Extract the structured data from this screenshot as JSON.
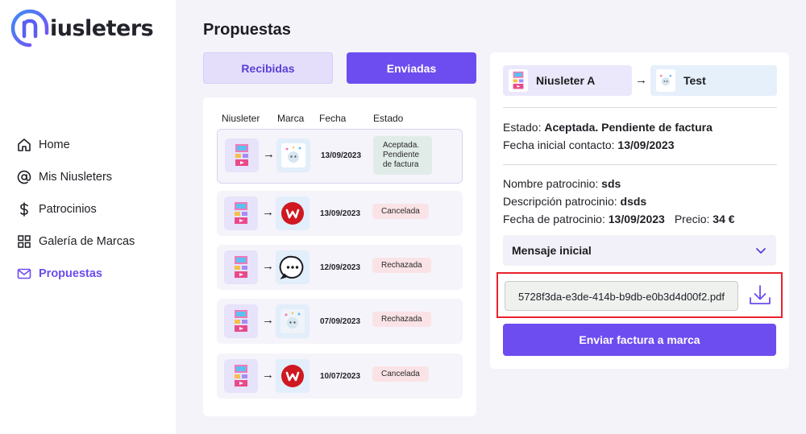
{
  "app": {
    "brand": "iusleters"
  },
  "sidebar": {
    "items": [
      {
        "label": "Home"
      },
      {
        "label": "Mis Niusleters"
      },
      {
        "label": "Patrocinios"
      },
      {
        "label": "Galería de Marcas"
      },
      {
        "label": "Propuestas"
      }
    ]
  },
  "page": {
    "title": "Propuestas"
  },
  "tabs": {
    "recibidas": "Recibidas",
    "enviadas": "Enviadas"
  },
  "list": {
    "headers": {
      "niusleter": "Niusleter",
      "marca": "Marca",
      "fecha": "Fecha",
      "estado": "Estado"
    },
    "rows": [
      {
        "date": "13/09/2023",
        "status": "Aceptada. Pendiente de factura"
      },
      {
        "date": "13/09/2023",
        "status": "Cancelada"
      },
      {
        "date": "12/09/2023",
        "status": "Rechazada"
      },
      {
        "date": "07/09/2023",
        "status": "Rechazada"
      },
      {
        "date": "10/07/2023",
        "status": "Cancelada"
      }
    ]
  },
  "detail": {
    "niusleter_name": "Niusleter A",
    "brand_name": "Test",
    "estado_label": "Estado:",
    "estado_value": "Aceptada. Pendiente de factura",
    "fecha_contacto_label": "Fecha inicial contacto:",
    "fecha_contacto_value": "13/09/2023",
    "nombre_label": "Nombre patrocinio:",
    "nombre_value": "sds",
    "descripcion_label": "Descripción patrocinio:",
    "descripcion_value": "dsds",
    "fecha_patrocinio_label": "Fecha de patrocinio:",
    "fecha_patrocinio_value": "13/09/2023",
    "precio_label": "Precio:",
    "precio_value": "34 €",
    "mensaje_inicial": "Mensaje inicial",
    "file_name": "5728f3da-e3de-414b-b9db-e0b3d4d00f2.pdf",
    "send_button": "Enviar factura a marca"
  },
  "colors": {
    "accent": "#6d4cf0",
    "highlight_border": "#e8232c"
  }
}
